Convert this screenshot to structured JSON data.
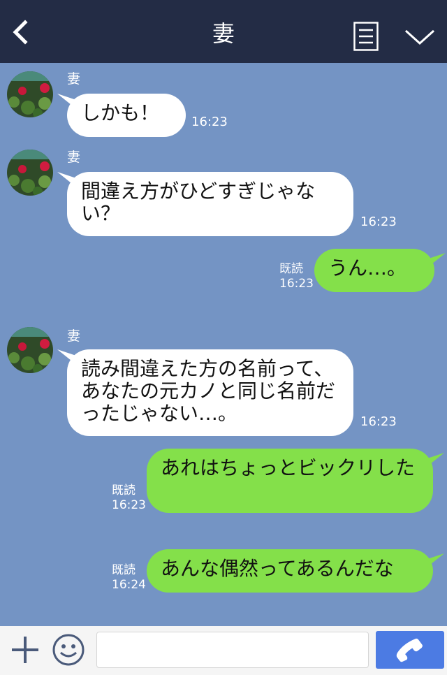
{
  "header": {
    "title": "妻"
  },
  "messages": [
    {
      "sender": "妻",
      "text": "しかも！",
      "time": "16:23"
    },
    {
      "sender": "妻",
      "text": "間違え方がひどすぎじゃない？",
      "time": "16:23"
    },
    {
      "read": "既読",
      "time": "16:23",
      "text": "うん…。"
    },
    {
      "sender": "妻",
      "text": "読み間違えた方の名前って、あなたの元カノと同じ名前だったじゃない…。",
      "time": "16:23"
    },
    {
      "read": "既読",
      "time": "16:23",
      "text": "あれはちょっとビックリした"
    },
    {
      "read": "既読",
      "time": "16:24",
      "text": "あんな偶然ってあるんだな"
    }
  ],
  "colors": {
    "header": "#232c45",
    "background": "#7494c4",
    "outgoing": "#84e04a",
    "incoming": "#ffffff",
    "send": "#4c7be3"
  },
  "icons": [
    "back-arrow-icon",
    "menu-icon",
    "chevron-down-icon",
    "plus-icon",
    "smile-icon",
    "phone-icon"
  ]
}
